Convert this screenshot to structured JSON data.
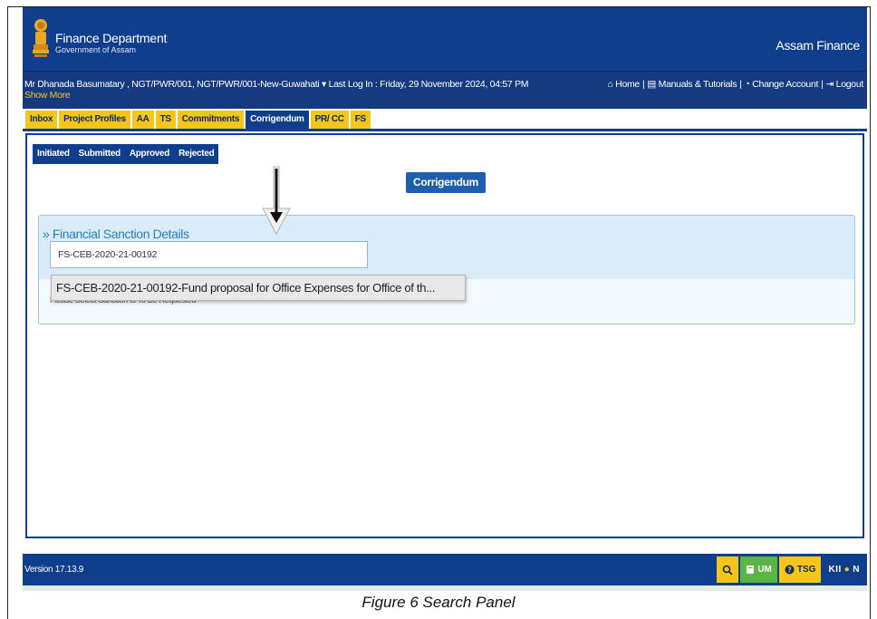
{
  "header": {
    "dept_name": "Finance Department",
    "dept_sub": "Government of Assam",
    "app_name": "Assam Finance"
  },
  "infobar": {
    "user_info": "Mr Dhanada Basumatary , NGT/PWR/001, NGT/PWR/001-New-Guwahati ▾   Last Log In : Friday, 29 November 2024, 04:57 PM",
    "show_more": "Show More",
    "links": {
      "home": "⌂ Home",
      "manuals": "▤ Manuals & Tutorials",
      "change_account": "◔ Change Account",
      "logout": "⇥ Logout"
    }
  },
  "tabs": {
    "inbox": "Inbox",
    "project_profiles": "Project Profiles",
    "aa": "AA",
    "ts": "TS",
    "commitments": "Commitments",
    "corrigendum": "Corrigendum",
    "prcc": "PR/ CC",
    "fs": "FS"
  },
  "subtabs": {
    "initiated": "Initiated",
    "submitted": "Submitted",
    "approved": "Approved",
    "rejected": "Rejected"
  },
  "main": {
    "corrigendum_label": "Corrigendum",
    "fs_title": "» Financial Sanction Details",
    "fs_input_value": "FS-CEB-2020-21-00192",
    "fs_hint": "Please Select Sanction Is To Be Requested",
    "suggestion": "FS-CEB-2020-21-00192-Fund proposal for Office Expenses for Office of th..."
  },
  "footer": {
    "version": "Version 17.13.9",
    "search_btn": "⚲",
    "um_btn": "UM",
    "tsg_btn": "TSG",
    "logo_a": "KII",
    "logo_b": "●",
    "logo_c": "N"
  },
  "caption": "Figure 6 Search Panel",
  "colors": {
    "primary": "#0f3f8c",
    "tab_yellow": "#f5c518",
    "accent_blue": "#1d5fae",
    "panel_light": "#d9ecf8"
  }
}
